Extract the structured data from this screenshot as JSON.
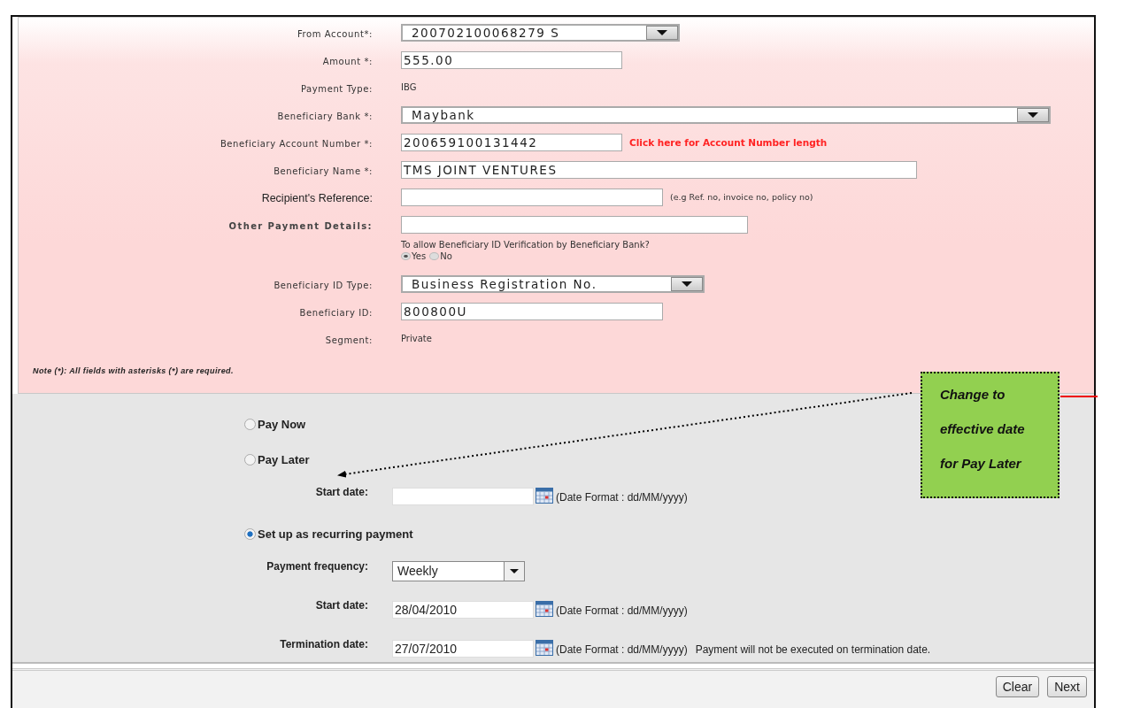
{
  "beneficiary_form": {
    "fields": [
      {
        "kind": "select",
        "label": "From Account*:",
        "value": "200702100068279 S"
      },
      {
        "kind": "input",
        "label": "Amount *:",
        "value": "555.00"
      },
      {
        "kind": "text",
        "label": "Payment Type:",
        "value": "IBG"
      },
      {
        "kind": "select",
        "label": "Beneficiary Bank *:",
        "value": "Maybank"
      },
      {
        "kind": "input",
        "label": "Beneficiary Account Number *:",
        "value": "200659100131442",
        "link": "Click here for Account Number length"
      },
      {
        "kind": "input",
        "label": "Beneficiary Name *:",
        "value": "TMS JOINT VENTURES"
      },
      {
        "kind": "input",
        "label": "Recipient's Reference:",
        "hint": "(e.g Ref. no, invoice no, policy no)"
      },
      {
        "kind": "input",
        "label": "Other Payment Details:"
      },
      {
        "kind": "radio",
        "question": "To allow Beneficiary ID Verification by Beneficiary Bank?",
        "options": [
          {
            "label": "Yes",
            "selected": true
          },
          {
            "label": "No",
            "selected": false
          }
        ]
      },
      {
        "kind": "select",
        "label": "Beneficiary ID Type:",
        "value": "Business Registration No."
      },
      {
        "kind": "input",
        "label": "Beneficiary ID:",
        "value": "800800U"
      },
      {
        "kind": "text",
        "label": "Segment:",
        "value": "Private"
      }
    ],
    "note": "Note (*): All fields with asterisks (*) are required."
  },
  "payment_timing": {
    "options": [
      {
        "label": "Pay Now",
        "selected": false
      },
      {
        "label": "Pay Later",
        "selected": false,
        "fields": [
          {
            "kind": "date",
            "label": "Start date:",
            "format": "(Date Format : dd/MM/yyyy)"
          }
        ]
      },
      {
        "label": "Set up as recurring payment",
        "selected": true,
        "fields": [
          {
            "kind": "select",
            "label": "Payment frequency:",
            "value": "Weekly"
          },
          {
            "kind": "date",
            "label": "Start date:",
            "value": "28/04/2010",
            "format": "(Date Format : dd/MM/yyyy)"
          },
          {
            "kind": "date",
            "label": "Termination date:",
            "value": "27/07/2010",
            "format": "(Date Format : dd/MM/yyyy)",
            "note": "Payment will not be executed on termination date."
          }
        ]
      }
    ]
  },
  "callout": {
    "lines": [
      "Change to",
      "effective date",
      "for Pay Later"
    ]
  },
  "buttons": [
    "Clear",
    "Next"
  ]
}
